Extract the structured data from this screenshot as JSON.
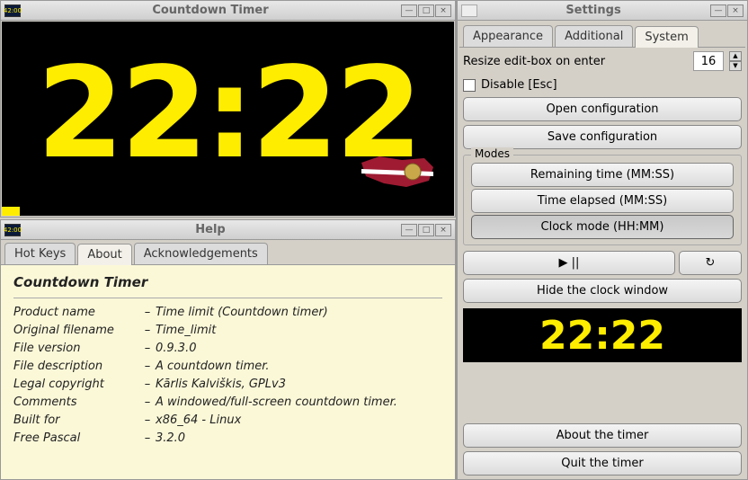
{
  "timer": {
    "title": "Countdown Timer",
    "icon_text": "42:00",
    "time": "22:22"
  },
  "help": {
    "title": "Help",
    "tabs": [
      "Hot Keys",
      "About",
      "Acknowledgements"
    ],
    "about_heading": "Countdown Timer",
    "rows": [
      {
        "label": "Product name",
        "value": "Time limit (Countdown timer)"
      },
      {
        "label": "Original filename",
        "value": "Time_limit"
      },
      {
        "label": "File version",
        "value": "0.9.3.0"
      },
      {
        "label": "File description",
        "value": "A countdown timer."
      },
      {
        "label": "Legal copyright",
        "value": "Kārlis Kalviškis, GPLv3"
      },
      {
        "label": "Comments",
        "value": "A windowed/full-screen countdown timer."
      },
      {
        "label": "Built for",
        "value": "x86_64 - Linux"
      },
      {
        "label": "Free Pascal",
        "value": "3.2.0"
      }
    ]
  },
  "settings": {
    "title": "Settings",
    "tabs": [
      "Appearance",
      "Additional",
      "System"
    ],
    "resize_label": "Resize edit-box on enter",
    "resize_value": "16",
    "disable_esc": "Disable [Esc]",
    "open_config": "Open configuration",
    "save_config": "Save configuration",
    "modes_label": "Modes",
    "mode_remaining": "Remaining time (MM:SS)",
    "mode_elapsed": "Time elapsed (MM:SS)",
    "mode_clock": "Clock mode (HH:MM)",
    "playpause": "▶ ||",
    "reload": "↻",
    "hide_clock": "Hide the clock window",
    "preview_time": "22:22",
    "about_btn": "About the timer",
    "quit_btn": "Quit the timer"
  }
}
